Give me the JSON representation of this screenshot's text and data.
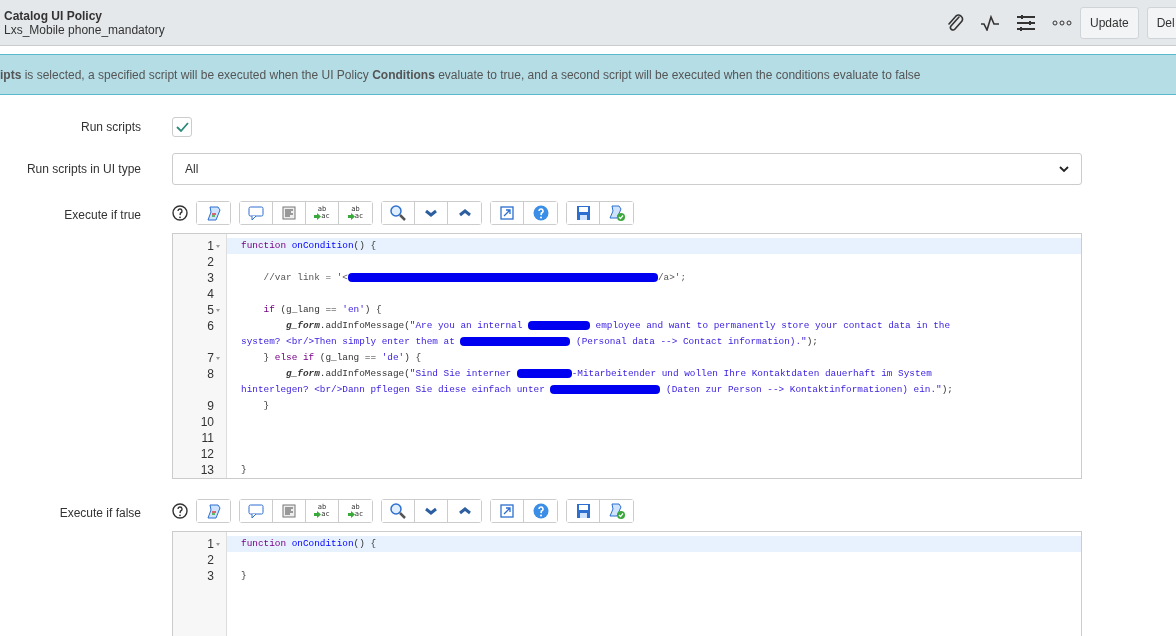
{
  "header": {
    "title": "Catalog UI Policy",
    "subtitle": "Lxs_Mobile phone_mandatory",
    "buttons": [
      {
        "label": "Update"
      },
      {
        "label": "Del"
      }
    ]
  },
  "info": "**ipts** is selected, a specified script will be executed when the UI Policy **Conditions** evaluate to true, and a second script will be executed when the conditions evaluate to false",
  "run_scripts": {
    "label": "Run scripts",
    "checked": true
  },
  "ui_type": {
    "label": "Run scripts in UI type",
    "value": "All"
  },
  "editors": [
    {
      "label": "Execute if true",
      "toolbar": [
        [
          {
            "kind": "format"
          }
        ],
        [
          {
            "kind": "comment"
          },
          {
            "kind": "lines"
          },
          {
            "kind": "replace",
            "top": "ab",
            "bottom": "ac"
          },
          {
            "kind": "replace-all",
            "top": "ab",
            "bottom": "ac"
          }
        ],
        [
          {
            "kind": "search"
          },
          {
            "kind": "next"
          },
          {
            "kind": "previous"
          }
        ],
        [
          {
            "kind": "fullscreen"
          },
          {
            "kind": "help"
          }
        ],
        [
          {
            "kind": "save"
          },
          {
            "kind": "check"
          }
        ]
      ],
      "lines": [
        {
          "number": "1",
          "fold": true,
          "active": true,
          "tokens": [
            {
              "kind": "keyword",
              "text": "function "
            },
            {
              "kind": "def",
              "text": "onCondition"
            },
            {
              "kind": "plain",
              "text": "() {"
            }
          ]
        },
        {
          "number": "2",
          "fold": false,
          "active": false
        },
        {
          "number": "3",
          "fold": false,
          "active": false,
          "tokens": [
            {
              "kind": "indent"
            },
            {
              "kind": "comment",
              "text": "//var link = '<"
            },
            {
              "kind": "redacted"
            },
            {
              "kind": "comment",
              "text": "/a>';"
            }
          ]
        },
        {
          "number": "4",
          "fold": false,
          "active": false
        },
        {
          "number": "5",
          "fold": true,
          "active": false,
          "tokens": [
            {
              "kind": "indent"
            },
            {
              "kind": "keyword",
              "text": "if"
            },
            {
              "kind": "plain",
              "text": " (g_lang == "
            },
            {
              "kind": "string",
              "text": "'en'"
            },
            {
              "kind": "plain",
              "text": ") {"
            }
          ]
        },
        {
          "number": "6",
          "fold": false,
          "active": false,
          "tokens": [
            {
              "kind": "indent"
            },
            {
              "kind": "indent"
            },
            {
              "kind": "var",
              "text": "g_form"
            },
            {
              "kind": "plain",
              "text": ".addInfoMessage("
            },
            {
              "kind": "string",
              "text": "\"Are you an internal "
            },
            {
              "kind": "redacted"
            },
            {
              "kind": "string",
              "text": " employee and want to permanently store your contact data in the"
            }
          ],
          "continuation": [
            {
              "kind": "string",
              "text": "system? <br/>Then simply enter them at "
            },
            {
              "kind": "redacted"
            },
            {
              "kind": "string",
              "text": " (Personal data --> Contact information).\""
            },
            {
              "kind": "plain",
              "text": ");"
            }
          ]
        },
        {
          "number": "7",
          "fold": true,
          "active": false,
          "tokens": [
            {
              "kind": "indent"
            },
            {
              "kind": "plain",
              "text": "} "
            },
            {
              "kind": "keyword",
              "text": "else if"
            },
            {
              "kind": "plain",
              "text": " (g_lang == "
            },
            {
              "kind": "string",
              "text": "'de'"
            },
            {
              "kind": "plain",
              "text": ") {"
            }
          ]
        },
        {
          "number": "8",
          "fold": false,
          "active": false,
          "tokens": [
            {
              "kind": "indent"
            },
            {
              "kind": "indent"
            },
            {
              "kind": "var",
              "text": "g_form"
            },
            {
              "kind": "plain",
              "text": ".addInfoMessage("
            },
            {
              "kind": "string",
              "text": "\"Sind Sie interner "
            },
            {
              "kind": "redacted"
            },
            {
              "kind": "string",
              "text": "-Mitarbeitender und wollen Ihre Kontaktdaten dauerhaft im System"
            }
          ],
          "continuation": [
            {
              "kind": "string",
              "text": "hinterlegen? <br/>Dann pflegen Sie diese einfach unter "
            },
            {
              "kind": "redacted"
            },
            {
              "kind": "string",
              "text": " (Daten zur Person --> Kontaktinformationen) ein.\""
            },
            {
              "kind": "plain",
              "text": ");"
            }
          ]
        },
        {
          "number": "9",
          "fold": false,
          "active": false,
          "tokens": [
            {
              "kind": "indent"
            },
            {
              "kind": "plain",
              "text": "}"
            }
          ]
        },
        {
          "number": "10",
          "fold": false,
          "active": false
        },
        {
          "number": "11",
          "fold": false,
          "active": false
        },
        {
          "number": "12",
          "fold": false,
          "active": false
        },
        {
          "number": "13",
          "fold": false,
          "active": false,
          "tokens": [
            {
              "kind": "plain",
              "text": "}"
            }
          ]
        }
      ]
    },
    {
      "label": "Execute if false",
      "toolbar": [
        [
          {
            "kind": "format"
          }
        ],
        [
          {
            "kind": "comment"
          },
          {
            "kind": "lines"
          },
          {
            "kind": "replace",
            "top": "ab",
            "bottom": "ac"
          },
          {
            "kind": "replace-all",
            "top": "ab",
            "bottom": "ac"
          }
        ],
        [
          {
            "kind": "search"
          },
          {
            "kind": "next"
          },
          {
            "kind": "previous"
          }
        ],
        [
          {
            "kind": "fullscreen"
          },
          {
            "kind": "help"
          }
        ],
        [
          {
            "kind": "save"
          },
          {
            "kind": "check"
          }
        ]
      ],
      "lines": [
        {
          "number": "1",
          "fold": true,
          "active": true,
          "tokens": [
            {
              "kind": "keyword",
              "text": "function "
            },
            {
              "kind": "def",
              "text": "onCondition"
            },
            {
              "kind": "plain",
              "text": "() {"
            }
          ]
        },
        {
          "number": "2",
          "fold": false,
          "active": false
        },
        {
          "number": "3",
          "fold": false,
          "active": false,
          "tokens": [
            {
              "kind": "plain",
              "text": "}"
            }
          ]
        }
      ]
    }
  ]
}
